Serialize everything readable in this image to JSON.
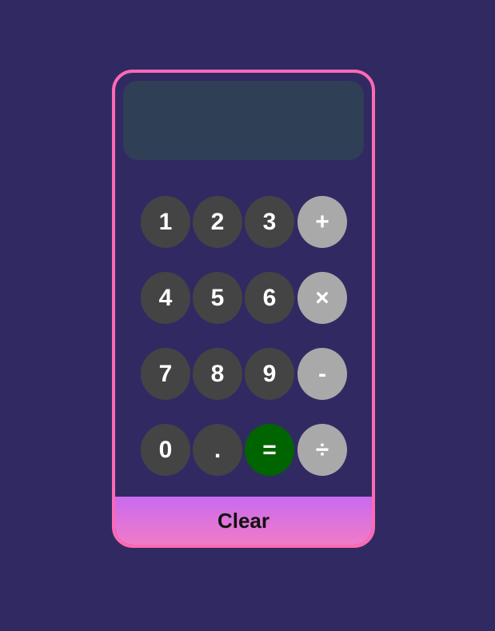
{
  "display": {
    "value": ""
  },
  "keys": {
    "one": "1",
    "two": "2",
    "three": "3",
    "plus": "+",
    "four": "4",
    "five": "5",
    "six": "6",
    "multiply": "×",
    "seven": "7",
    "eight": "8",
    "nine": "9",
    "minus": "-",
    "zero": "0",
    "decimal": ".",
    "equals": "=",
    "divide": "÷"
  },
  "clear_label": "Clear",
  "colors": {
    "page_background": "#312a62",
    "calculator_border": "#ff69b4",
    "display_background": "#2f3f55",
    "number_key": "#444444",
    "operator_key": "#a9a9a9",
    "equals_key": "#006400",
    "clear_gradient_start": "#c96af0",
    "clear_gradient_end": "#f07bc6"
  }
}
